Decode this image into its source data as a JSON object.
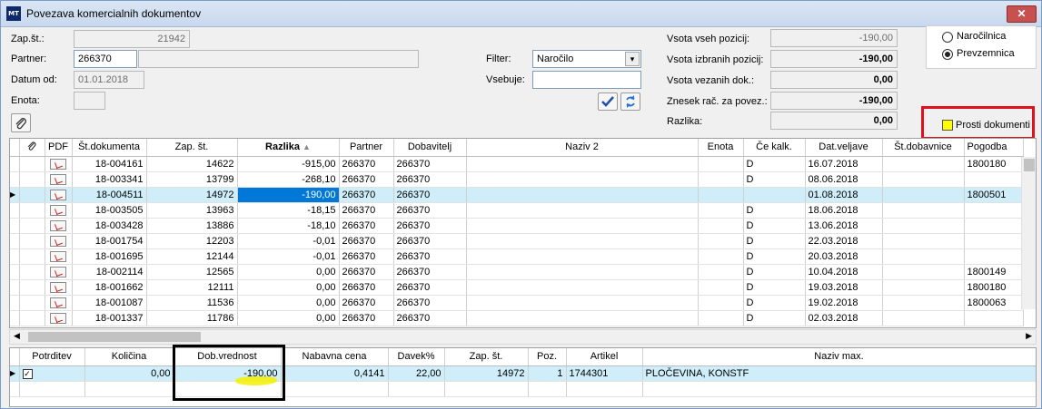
{
  "window": {
    "title": "Povezava komercialnih dokumentov",
    "app_icon_text": "MT",
    "close_glyph": "✕"
  },
  "form": {
    "zapst_label": "Zap.št.:",
    "zapst_value": "21942",
    "partner_label": "Partner:",
    "partner_value": "266370",
    "partner_name": "",
    "datum_label": "Datum od:",
    "datum_value": "01.01.2018",
    "enota_label": "Enota:",
    "enota_value": "",
    "filter_label": "Filter:",
    "filter_value": "Naročilo",
    "vsebuje_label": "Vsebuje:",
    "vsebuje_value": ""
  },
  "totals": {
    "vsota_vseh_label": "Vsota vseh pozicij:",
    "vsota_vseh": "-190,00",
    "vsota_izbranih_label": "Vsota izbranih pozicij:",
    "vsota_izbranih": "-190,00",
    "vsota_vezanih_label": "Vsota vezanih dok.:",
    "vsota_vezanih": "0,00",
    "znesek_label": "Znesek rač. za povez.:",
    "znesek": "-190,00",
    "razlika_label": "Razlika:",
    "razlika": "0,00"
  },
  "options": {
    "narocilnica": "Naročilnica",
    "prevzemnica": "Prevzemnica",
    "prosti": "Prosti dokumenti"
  },
  "grid": {
    "headers": [
      "PDF",
      "Št.dokumenta",
      "Zap. št.",
      "Razlika",
      "Partner",
      "Dobavitelj",
      "Naziv 2",
      "Enota",
      "Če kalk.",
      "Dat.veljave",
      "Št.dobavnice",
      "Pogodba"
    ],
    "sort_indicator": "▲",
    "rows": [
      [
        "18-004161",
        "14622",
        "-915,00",
        "266370",
        "266370",
        "",
        "",
        "D",
        "16.07.2018",
        "",
        "1800180"
      ],
      [
        "18-003341",
        "13799",
        "-268,10",
        "266370",
        "266370",
        "",
        "",
        "D",
        "08.06.2018",
        "",
        ""
      ],
      [
        "18-004511",
        "14972",
        "-190,00",
        "266370",
        "266370",
        "",
        "",
        "",
        "01.08.2018",
        "",
        "1800501"
      ],
      [
        "18-003505",
        "13963",
        "-18,15",
        "266370",
        "266370",
        "",
        "",
        "D",
        "18.06.2018",
        "",
        ""
      ],
      [
        "18-003428",
        "13886",
        "-18,10",
        "266370",
        "266370",
        "",
        "",
        "D",
        "13.06.2018",
        "",
        ""
      ],
      [
        "18-001754",
        "12203",
        "-0,01",
        "266370",
        "266370",
        "",
        "",
        "D",
        "22.03.2018",
        "",
        ""
      ],
      [
        "18-001695",
        "12144",
        "-0,01",
        "266370",
        "266370",
        "",
        "",
        "D",
        "20.03.2018",
        "",
        ""
      ],
      [
        "18-002114",
        "12565",
        "0,00",
        "266370",
        "266370",
        "",
        "",
        "D",
        "10.04.2018",
        "",
        "1800149"
      ],
      [
        "18-001662",
        "12111",
        "0,00",
        "266370",
        "266370",
        "",
        "",
        "D",
        "19.03.2018",
        "",
        "1800180"
      ],
      [
        "18-001087",
        "11536",
        "0,00",
        "266370",
        "266370",
        "",
        "",
        "D",
        "19.02.2018",
        "",
        "1800063"
      ],
      [
        "18-001337",
        "11786",
        "0,00",
        "266370",
        "266370",
        "",
        "",
        "D",
        "02.03.2018",
        "",
        ""
      ]
    ]
  },
  "detail": {
    "headers": [
      "Potrditev",
      "Količina",
      "Dob.vrednost",
      "Nabavna cena",
      "Davek%",
      "Zap. št.",
      "Poz.",
      "Artikel",
      "Naziv max."
    ],
    "row": [
      "",
      "0,00",
      "-190,00",
      "0,4141",
      "22,00",
      "14972",
      "1",
      "1744301",
      "PLOČEVINA, KONSTF"
    ]
  }
}
